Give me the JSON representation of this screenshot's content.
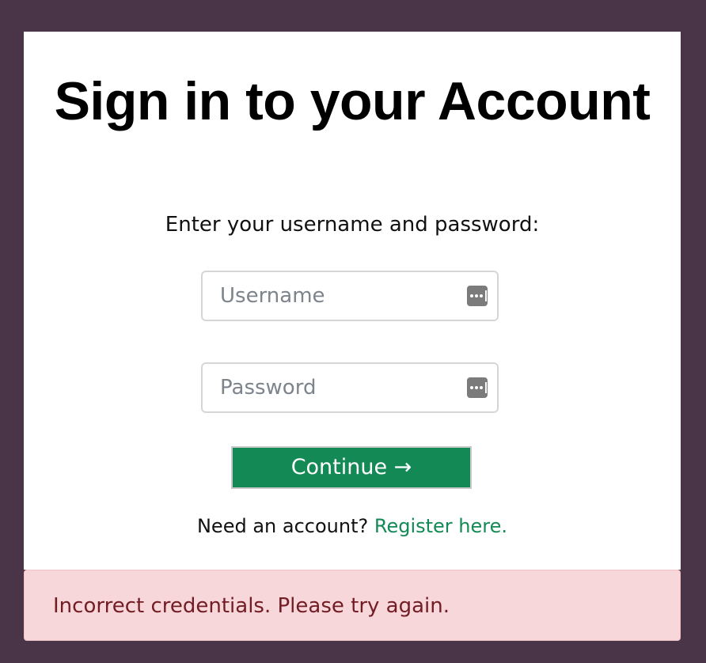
{
  "login": {
    "title": "Sign in to your Account",
    "subtitle": "Enter your username and password:",
    "username": {
      "placeholder": "Username",
      "value": ""
    },
    "password": {
      "placeholder": "Password",
      "value": ""
    },
    "continue_label": "Continue →",
    "register_prompt": "Need an account?",
    "register_link": "Register here."
  },
  "alert": {
    "message": "Incorrect credentials. Please try again."
  },
  "icons": {
    "field_icon": "password-manager-icon"
  },
  "colors": {
    "page_bg": "#4a3548",
    "card_bg": "#ffffff",
    "accent": "#138a55",
    "alert_bg": "#f8d7da",
    "alert_text": "#721c24"
  }
}
